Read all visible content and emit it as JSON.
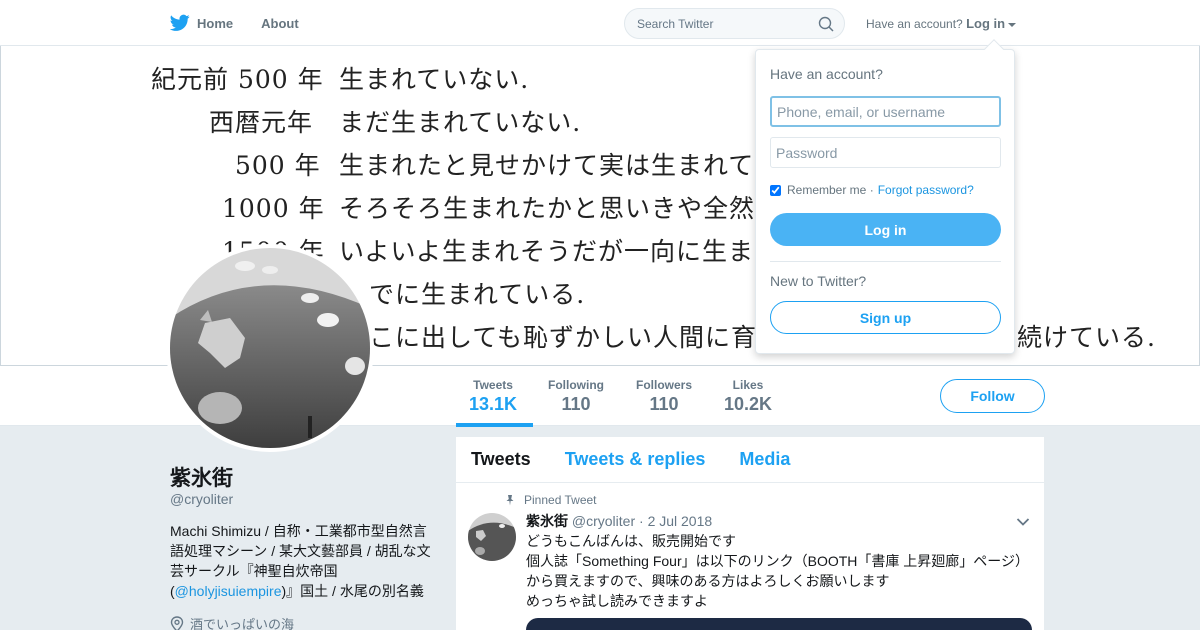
{
  "nav": {
    "home_label": "Home",
    "about_label": "About",
    "search_placeholder": "Search Twitter",
    "account_prompt": "Have an account?",
    "login_label": "Log in"
  },
  "banner": {
    "lines": [
      {
        "year": "紀元前 500 年",
        "text": "生まれていない."
      },
      {
        "year": "西暦元年",
        "text": "まだ生まれていない."
      },
      {
        "year": "500 年",
        "text": "生まれたと見せかけて実は生まれて"
      },
      {
        "year": "1000 年",
        "text": "そろそろ生まれたかと思いきや全然"
      },
      {
        "year": "1500 年",
        "text": "いよいよ生まれそうだが一向に生ま"
      },
      {
        "year": "",
        "text": "でに生まれている."
      },
      {
        "year": "",
        "text": "こに出しても恥ずかしい人間に育"
      },
      {
        "year": "",
        "text": "続けている."
      }
    ]
  },
  "stats": [
    {
      "label": "Tweets",
      "value": "13.1K"
    },
    {
      "label": "Following",
      "value": "110"
    },
    {
      "label": "Followers",
      "value": "110"
    },
    {
      "label": "Likes",
      "value": "10.2K"
    }
  ],
  "follow_label": "Follow",
  "profile": {
    "name": "紫氷街",
    "handle": "@cryoliter",
    "bio_before": "Machi Shimizu / 自称・工業都市型自然言語処理マシーン / 某大文藝部員 / 胡乱な文芸サークル『神聖自炊帝国(",
    "bio_link": "@holyjisuiempire",
    "bio_after": ")』国土 / 水尾の別名義",
    "location": "酒でいっぱいの海"
  },
  "timeline": {
    "tabs": [
      "Tweets",
      "Tweets & replies",
      "Media"
    ],
    "pinned_label": "Pinned Tweet",
    "tweet": {
      "name": "紫氷街",
      "handle": "@cryoliter",
      "date": "2 Jul 2018",
      "lines": [
        "どうもこんばんは、販売開始です",
        "個人誌「Something Four」は以下のリンク（BOOTH「書庫 上昇廻廊」ページ）から買えますので、興味のある方はよろしくお願いします",
        "めっちゃ試し読みできますよ"
      ]
    }
  },
  "login": {
    "title": "Have an account?",
    "user_placeholder": "Phone, email, or username",
    "password_placeholder": "Password",
    "remember_label": "Remember me",
    "forgot_label": "Forgot password?",
    "login_button": "Log in",
    "new_prompt": "New to Twitter?",
    "signup_button": "Sign up"
  },
  "colors": {
    "accent": "#1da1f2",
    "login_button": "#4ab3f4",
    "background": "#e6ecf0"
  }
}
